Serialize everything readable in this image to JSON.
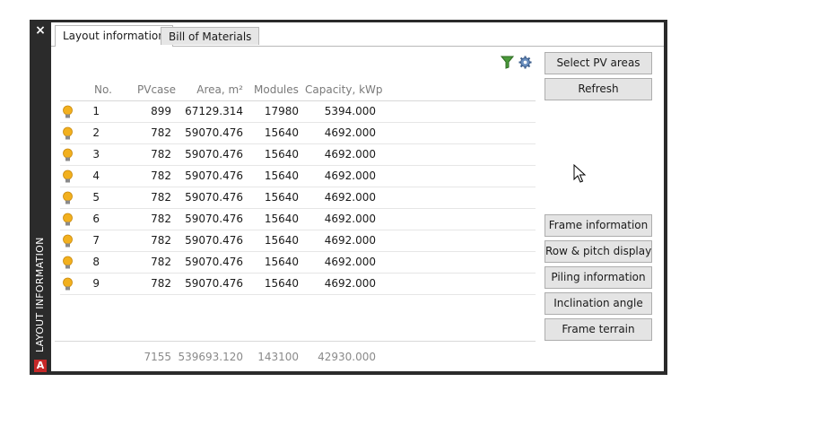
{
  "panel": {
    "vertical_title": "LAYOUT INFORMATION",
    "close_glyph": "×",
    "app_logo_letter": "A"
  },
  "tabs": [
    {
      "label": "Layout information",
      "active": true
    },
    {
      "label": "Bill of Materials",
      "active": false
    }
  ],
  "toolbar": {
    "filter_icon": "filter-icon",
    "settings_icon": "gear-icon"
  },
  "table": {
    "columns": [
      "No.",
      "PVcase",
      "Area, m²",
      "Modules",
      "Capacity, kWp"
    ],
    "rows": [
      {
        "no": "1",
        "pvcase": "899",
        "area": "67129.314",
        "modules": "17980",
        "capacity": "5394.000"
      },
      {
        "no": "2",
        "pvcase": "782",
        "area": "59070.476",
        "modules": "15640",
        "capacity": "4692.000"
      },
      {
        "no": "3",
        "pvcase": "782",
        "area": "59070.476",
        "modules": "15640",
        "capacity": "4692.000"
      },
      {
        "no": "4",
        "pvcase": "782",
        "area": "59070.476",
        "modules": "15640",
        "capacity": "4692.000"
      },
      {
        "no": "5",
        "pvcase": "782",
        "area": "59070.476",
        "modules": "15640",
        "capacity": "4692.000"
      },
      {
        "no": "6",
        "pvcase": "782",
        "area": "59070.476",
        "modules": "15640",
        "capacity": "4692.000"
      },
      {
        "no": "7",
        "pvcase": "782",
        "area": "59070.476",
        "modules": "15640",
        "capacity": "4692.000"
      },
      {
        "no": "8",
        "pvcase": "782",
        "area": "59070.476",
        "modules": "15640",
        "capacity": "4692.000"
      },
      {
        "no": "9",
        "pvcase": "782",
        "area": "59070.476",
        "modules": "15640",
        "capacity": "4692.000"
      }
    ],
    "totals": {
      "pvcase": "7155",
      "area": "539693.120",
      "modules": "143100",
      "capacity": "42930.000"
    }
  },
  "buttons": {
    "select_pv_areas": "Select PV areas",
    "refresh": "Refresh",
    "frame_information": "Frame information",
    "row_pitch_display": "Row & pitch display",
    "piling_information": "Piling information",
    "inclination_angle": "Inclination angle",
    "frame_terrain": "Frame terrain"
  },
  "colors": {
    "panel_dark": "#2b2b2b",
    "bulb": "#f2b01e",
    "button_bg": "#e4e4e4",
    "autocad_red": "#c62828"
  }
}
